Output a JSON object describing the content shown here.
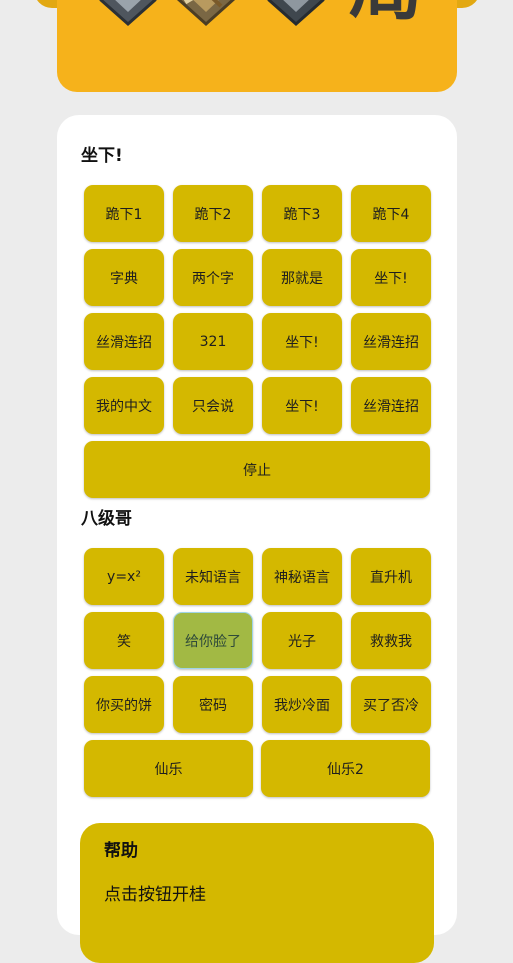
{
  "banner": {
    "glyph": "局",
    "badges": [
      "silver-rank-icon",
      "bronze-rank-icon",
      "silver-plane-icon"
    ]
  },
  "section1": {
    "title": "坐下!",
    "buttons": [
      "跪下1",
      "跪下2",
      "跪下3",
      "跪下4",
      "字典",
      "两个字",
      "那就是",
      "坐下!",
      "丝滑连招",
      "321",
      "坐下!",
      "丝滑连招",
      "我的中文",
      "只会说",
      "坐下!",
      "丝滑连招"
    ],
    "stop_label": "停止"
  },
  "section2": {
    "title": "八级哥",
    "buttons": [
      "y=x²",
      "未知语言",
      "神秘语言",
      "直升机",
      "笑",
      "给你脸了",
      "光子",
      "救救我",
      "你买的饼",
      "密码",
      "我炒冷面",
      "买了否冷"
    ],
    "wide_buttons": [
      "仙乐",
      "仙乐2"
    ],
    "selected": "给你脸了"
  },
  "help": {
    "title": "帮助",
    "body": "点击按钮开桂"
  },
  "colors": {
    "banner": "#f6b21b",
    "button": "#d4b800",
    "selected_button": "#a2b944"
  }
}
